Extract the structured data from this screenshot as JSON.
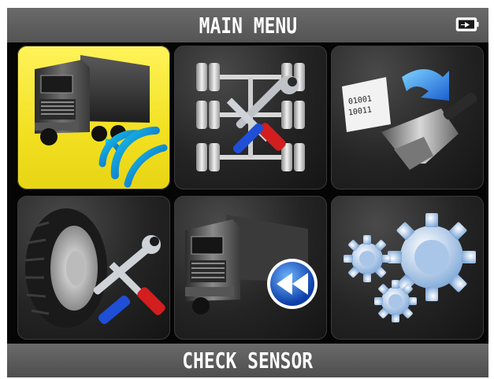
{
  "header": {
    "title": "MAIN MENU",
    "battery_icon": "battery-plug-icon"
  },
  "tiles": [
    {
      "icon": "truck-wireless-icon",
      "selected": true
    },
    {
      "icon": "axle-service-icon",
      "selected": false
    },
    {
      "icon": "sensor-programming-icon",
      "selected": false
    },
    {
      "icon": "tire-service-icon",
      "selected": false
    },
    {
      "icon": "truck-rewind-icon",
      "selected": false
    },
    {
      "icon": "gears-settings-icon",
      "selected": false
    }
  ],
  "footer": {
    "label": "CHECK SENSOR"
  },
  "colors": {
    "selected": "#f2e021",
    "header": "#5e5e5e",
    "background": "#050505"
  }
}
